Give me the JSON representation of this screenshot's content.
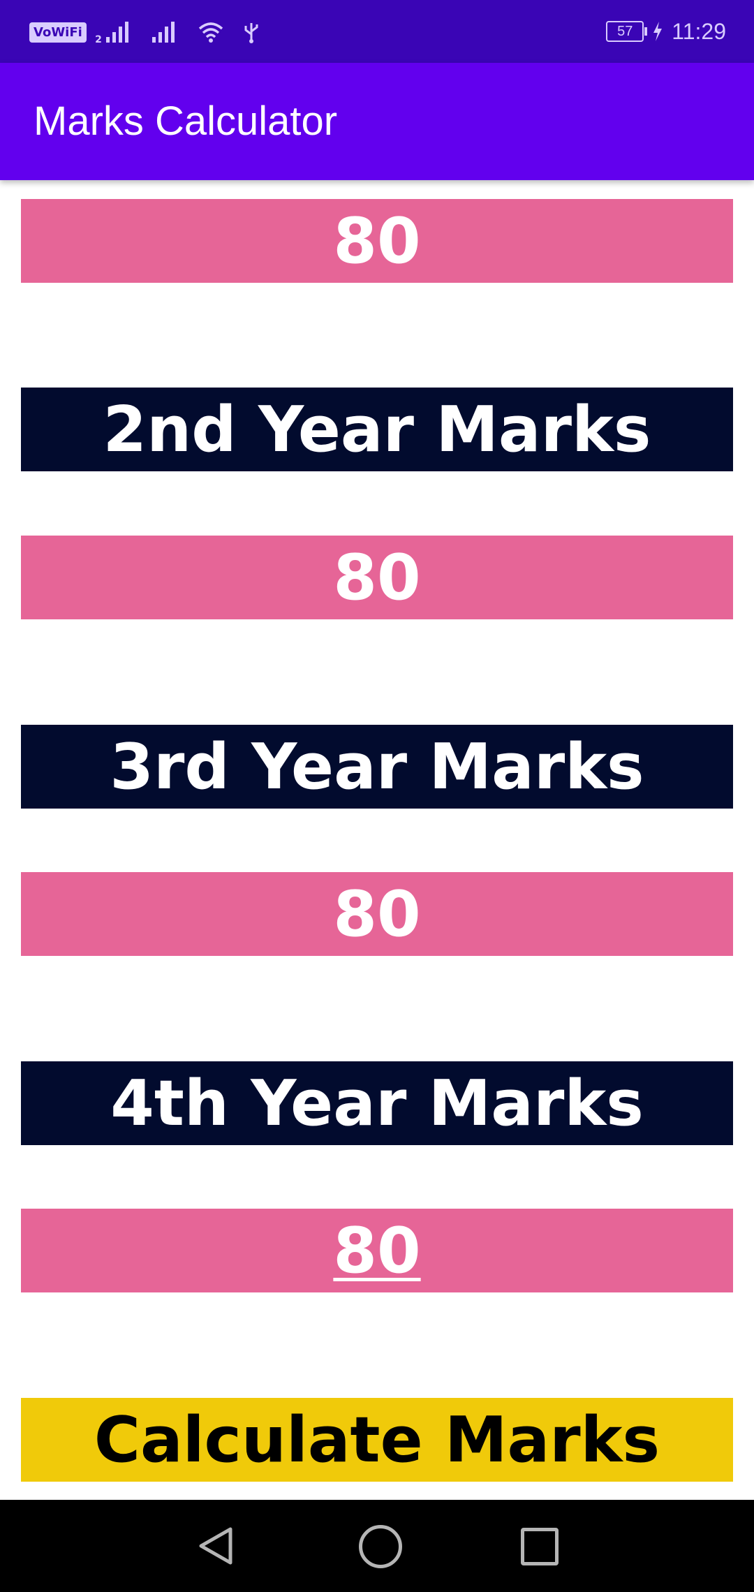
{
  "status_bar": {
    "vowifi": "VoWiFi",
    "vowifi_sub": "2",
    "battery": "57",
    "time": "11:29"
  },
  "app_bar": {
    "title": "Marks Calculator"
  },
  "form": {
    "year1_value": "80",
    "year2_label": "2nd Year Marks",
    "year2_value": "80",
    "year3_label": "3rd Year Marks",
    "year3_value": "80",
    "year4_label": "4th Year Marks",
    "year4_value": "80",
    "calculate_label": "Calculate Marks"
  },
  "colors": {
    "status_bar": "#3a05b5",
    "app_bar": "#6200ee",
    "mark_field": "#e66597",
    "label_bar": "#020b2e",
    "button": "#f0ca0a"
  }
}
